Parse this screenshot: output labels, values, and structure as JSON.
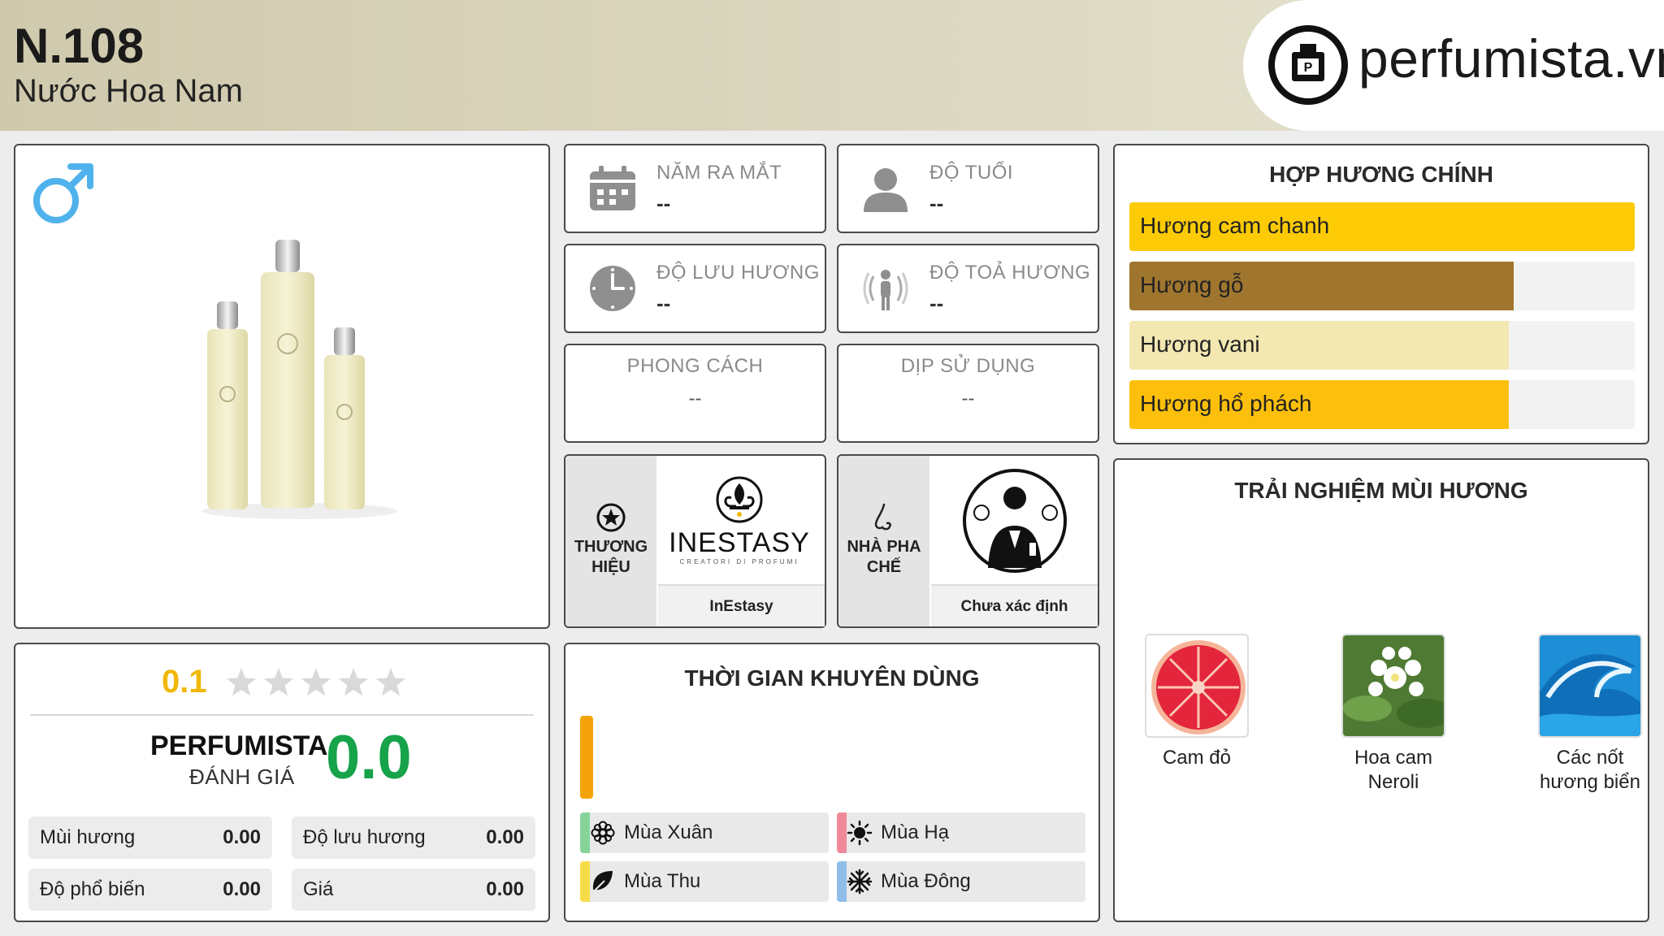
{
  "header": {
    "title": "N.108",
    "subtitle": "Nước Hoa Nam",
    "logo_text": "perfumista.vn"
  },
  "product": {
    "gender_icon": "male-symbol-icon",
    "image_label": "perfume-bottles-image"
  },
  "info": {
    "launch_year": {
      "label": "NĂM RA MẮT",
      "value": "--",
      "icon": "calendar-icon"
    },
    "age": {
      "label": "ĐỘ TUỔI",
      "value": "--",
      "icon": "person-icon"
    },
    "longevity": {
      "label": "ĐỘ LƯU HƯƠNG",
      "value": "--",
      "icon": "clock-icon"
    },
    "sillage": {
      "label": "ĐỘ TOẢ HƯƠNG",
      "value": "--",
      "icon": "sillage-icon"
    },
    "style": {
      "label": "PHONG CÁCH",
      "value": "--"
    },
    "occasion": {
      "label": "DỊP SỬ DỤNG",
      "value": "--"
    }
  },
  "brand": {
    "label": "THƯƠNG HIỆU",
    "name": "InEstasy",
    "logo_text": "INESTASY",
    "logo_tagline": "CREATORI DI PROFUMI"
  },
  "perfumer": {
    "label": "NHÀ PHA CHẾ",
    "name": "Chưa xác định"
  },
  "accords": {
    "title": "HỢP HƯƠNG CHÍNH",
    "items": [
      {
        "label": "Hương cam chanh",
        "pct": 100,
        "color": "#fccb06"
      },
      {
        "label": "Hương gỗ",
        "pct": 76,
        "color": "#a0762e"
      },
      {
        "label": "Hương vani",
        "pct": 75,
        "color": "#f3e7b2"
      },
      {
        "label": "Hương hổ phách",
        "pct": 75,
        "color": "#fcbf0b"
      }
    ]
  },
  "notes": {
    "title": "TRẢI NGHIỆM MÙI HƯƠNG",
    "items": [
      {
        "name": "Cam đỏ"
      },
      {
        "name": "Hoa cam Neroli"
      },
      {
        "name": "Các nốt hương biển"
      }
    ]
  },
  "rating": {
    "user_score": "0.1",
    "stars_filled": 0,
    "stars_total": 5,
    "perfumista_label": "PERFUMISTA",
    "perfumista_sub": "ĐÁNH GIÁ",
    "perfumista_score": "0.0",
    "metrics": [
      {
        "label": "Mùi hương",
        "value": "0.00"
      },
      {
        "label": "Độ lưu hương",
        "value": "0.00"
      },
      {
        "label": "Độ phổ biến",
        "value": "0.00"
      },
      {
        "label": "Giá",
        "value": "0.00"
      }
    ]
  },
  "time": {
    "title": "THỜI GIAN KHUYÊN DÙNG",
    "seasons": [
      {
        "label": "Mùa Xuân",
        "color": "#86d39a",
        "icon": "flower-icon"
      },
      {
        "label": "Mùa Hạ",
        "color": "#f08a9b",
        "icon": "sun-icon"
      },
      {
        "label": "Mùa Thu",
        "color": "#f7dc4a",
        "icon": "leaf-icon"
      },
      {
        "label": "Mùa Đông",
        "color": "#8fbfe8",
        "icon": "snowflake-icon"
      }
    ]
  }
}
